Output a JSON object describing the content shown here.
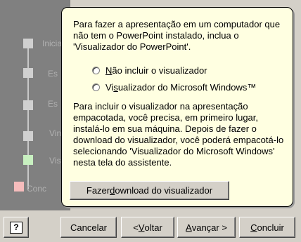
{
  "steps": [
    {
      "label": "Inicia"
    },
    {
      "label": "Es"
    },
    {
      "label": "Es"
    },
    {
      "label": "Vin"
    },
    {
      "label": "Vis"
    },
    {
      "label": "Conc"
    }
  ],
  "balloon": {
    "intro": "Para fazer a apresentação em um computador que não tem o PowerPoint instalado, inclua o 'Visualizador do PowerPoint'.",
    "radio1_pre": "",
    "radio1_accel": "N",
    "radio1_post": "ão incluir o visualizador",
    "radio2_pre": "Vi",
    "radio2_accel": "s",
    "radio2_post": "ualizador do Microsoft Windows™",
    "info": "Para incluir o visualizador na apresentação empacotada, você precisa, em primeiro lugar, instalá-lo em sua máquina. Depois de fazer o download do visualizador, você poderá empacotá-lo selecionando 'Visualizador do Microsoft Windows' nesta tela do assistente.",
    "download_pre": "Fazer ",
    "download_accel": "d",
    "download_post": "ownload do visualizador"
  },
  "buttons": {
    "help_icon": "?",
    "cancel": "Cancelar",
    "back_pre": "< ",
    "back_accel": "V",
    "back_post": "oltar",
    "next_pre": "",
    "next_accel": "A",
    "next_post": "vançar >",
    "finish_pre": "",
    "finish_accel": "C",
    "finish_post": "oncluir"
  }
}
